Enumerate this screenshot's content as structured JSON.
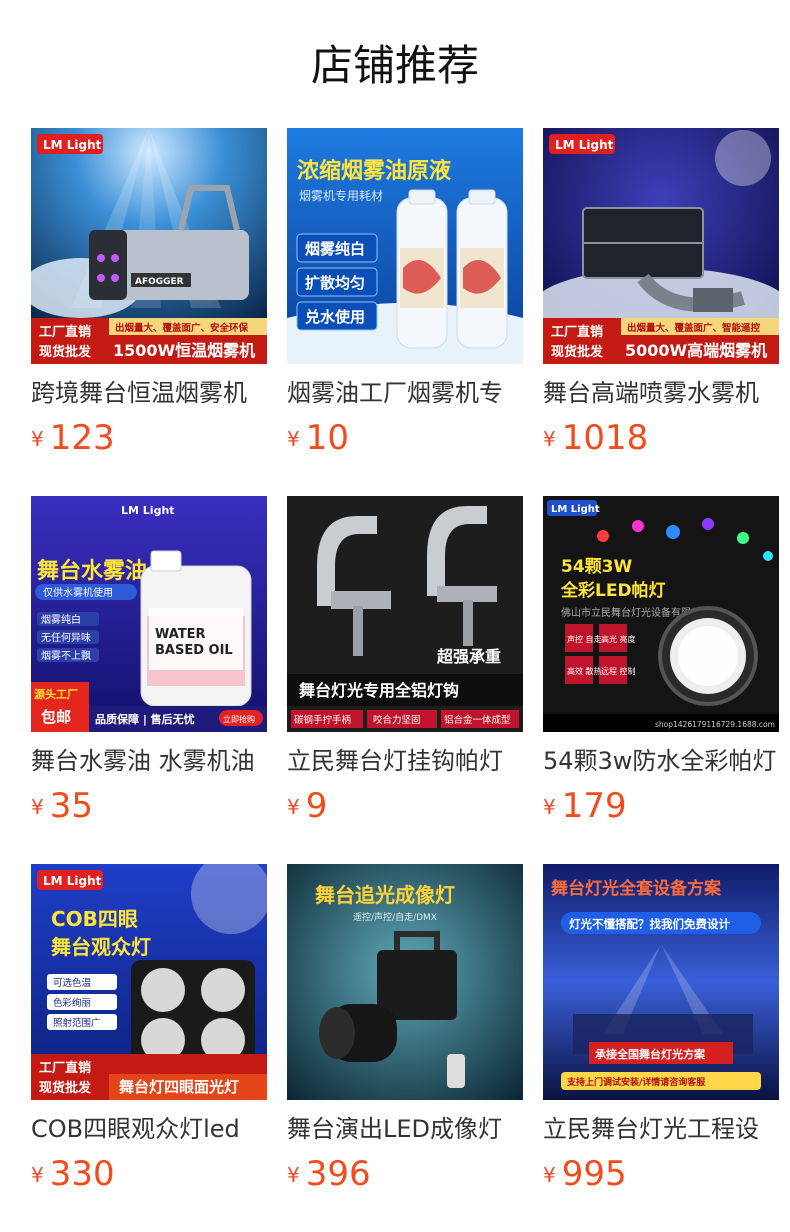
{
  "section": {
    "title": "店铺推荐"
  },
  "currency_symbol": "¥",
  "colors": {
    "price": "#f24c1c",
    "brand_red": "#d9261c",
    "title": "#111111"
  },
  "products": [
    {
      "name": "跨境舞台恒温烟雾机",
      "price": "123",
      "image": {
        "logo": "LM Light",
        "brand": "AFOGGER",
        "tag_left_top": "工厂直销",
        "tag_left_bottom": "现货批发",
        "tag_right_top": "出烟量大、覆盖面广、安全环保",
        "tag_right_bottom": "1500W恒温烟雾机"
      }
    },
    {
      "name": "烟雾油工厂烟雾机专",
      "price": "10",
      "image": {
        "headline": "浓缩烟雾油原液",
        "subline": "烟雾机专用耗材",
        "features": [
          "烟雾纯白",
          "扩散均匀",
          "兑水使用"
        ]
      }
    },
    {
      "name": "舞台高端喷雾水雾机",
      "price": "1018",
      "image": {
        "logo": "LM Light",
        "tag_left_top": "工厂直销",
        "tag_left_bottom": "现货批发",
        "tag_right_top": "出烟量大、覆盖面广、智能遥控",
        "tag_right_bottom": "5000W高端烟雾机"
      }
    },
    {
      "name": "舞台水雾油 水雾机油",
      "price": "35",
      "image": {
        "logo": "LM Light",
        "headline": "舞台水雾油",
        "subline": "仅供水雾机使用",
        "features": [
          "烟雾纯白",
          "无任何异味",
          "烟雾不上飘"
        ],
        "bottle_label_1": "WATER",
        "bottle_label_2": "BASED OIL",
        "badge_top": "源头工厂",
        "badge_bottom": "包邮",
        "footer": "品质保障 | 售后无忧",
        "footer_button": "立即抢购"
      }
    },
    {
      "name": "立民舞台灯挂钩帕灯",
      "price": "9",
      "image": {
        "slogan": "超强承重",
        "headline": "舞台灯光专用全铝灯钩",
        "features": [
          "碳钢手拧手柄",
          "咬合力坚固",
          "铝合金一体成型"
        ]
      }
    },
    {
      "name": "54颗3w防水全彩帕灯",
      "price": "179",
      "image": {
        "logo": "LM Light",
        "headline_1": "54颗3W",
        "headline_2": "全彩LED帕灯",
        "watermark": "佛山市立民舞台灯光设备有限公司",
        "features": [
          "声控 自走",
          "高光 亮度",
          "高效 散热",
          "远程 控制"
        ],
        "footer": "shop1426179116729.1688.com"
      }
    },
    {
      "name": "COB四眼观众灯led",
      "price": "330",
      "image": {
        "logo": "LM Light",
        "headline_1": "COB四眼",
        "headline_2": "舞台观众灯",
        "features": [
          "可选色温",
          "色彩绚丽",
          "照射范围广"
        ],
        "tag_left_top": "工厂直销",
        "tag_left_bottom": "现货批发",
        "tag_right": "舞台灯四眼面光灯"
      }
    },
    {
      "name": "舞台演出LED成像灯",
      "price": "396",
      "image": {
        "headline": "舞台追光成像灯",
        "subline": "遥控/声控/自走/DMX"
      }
    },
    {
      "name": "立民舞台灯光工程设",
      "price": "995",
      "image": {
        "headline": "舞台灯光全套设备方案",
        "subline": "灯光不懂搭配？找我们免费设计",
        "banner": "承接全国舞台灯光方案",
        "footer": "支持上门调试安装/详情请咨询客服"
      }
    }
  ]
}
